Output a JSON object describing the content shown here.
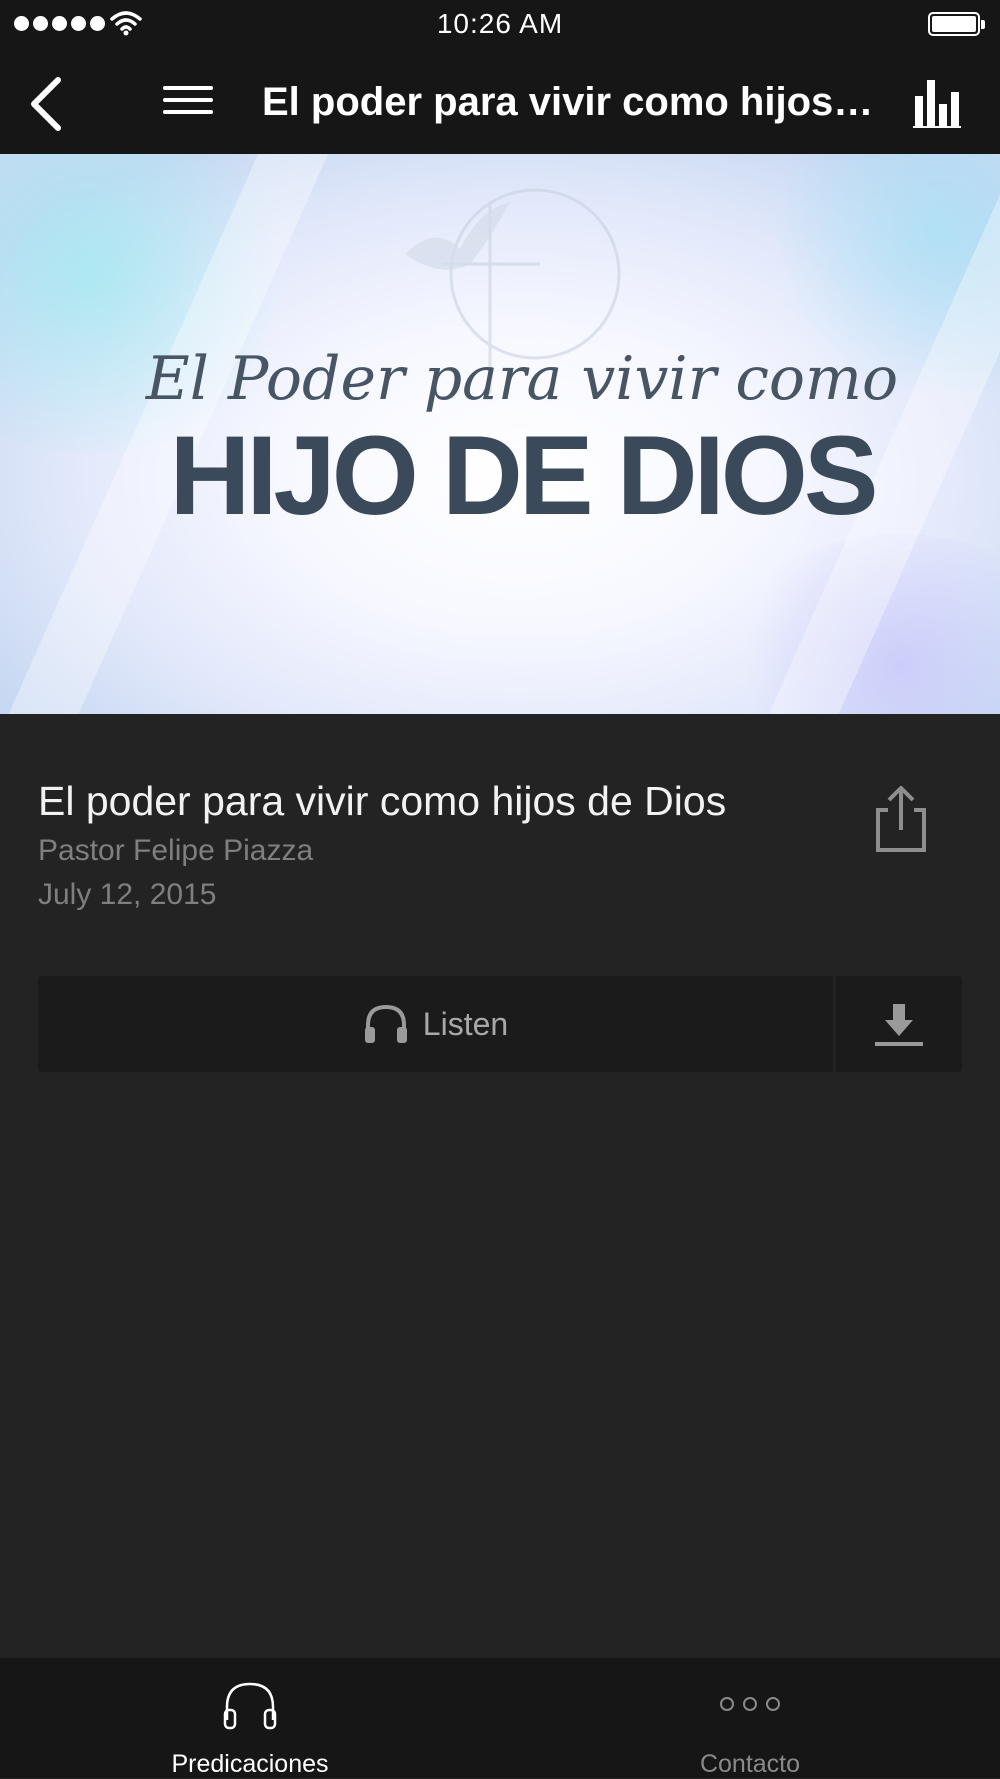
{
  "status_bar": {
    "time": "10:26 AM",
    "signal_icon": "signal-dots-icon",
    "wifi_icon": "wifi-icon",
    "battery_icon": "battery-icon",
    "battery_level": 1.0
  },
  "nav": {
    "title": "El poder para vivir como hijos de Dios",
    "back_icon": "chevron-left-icon",
    "menu_icon": "hamburger-menu-icon",
    "stats_icon": "bar-chart-icon"
  },
  "hero": {
    "script_text": "El Poder para vivir como",
    "headline": "HIJO DE DIOS"
  },
  "sermon": {
    "title": "El poder para vivir como hijos de Dios",
    "author": "Pastor Felipe Piazza",
    "date": "July 12, 2015",
    "share_icon": "share-icon"
  },
  "actions": {
    "listen_label": "Listen",
    "listen_icon": "headphones-icon",
    "download_icon": "download-icon"
  },
  "tabs": [
    {
      "label": "Predicaciones",
      "icon": "headphones-icon",
      "active": true
    },
    {
      "label": "Contacto",
      "icon": "more-dots-icon",
      "active": false
    }
  ],
  "colors": {
    "background": "#232323",
    "bar": "#161616",
    "button": "#1b1b1b",
    "tab_active": "#ffffff",
    "tab_inactive": "#8a8a8a"
  }
}
